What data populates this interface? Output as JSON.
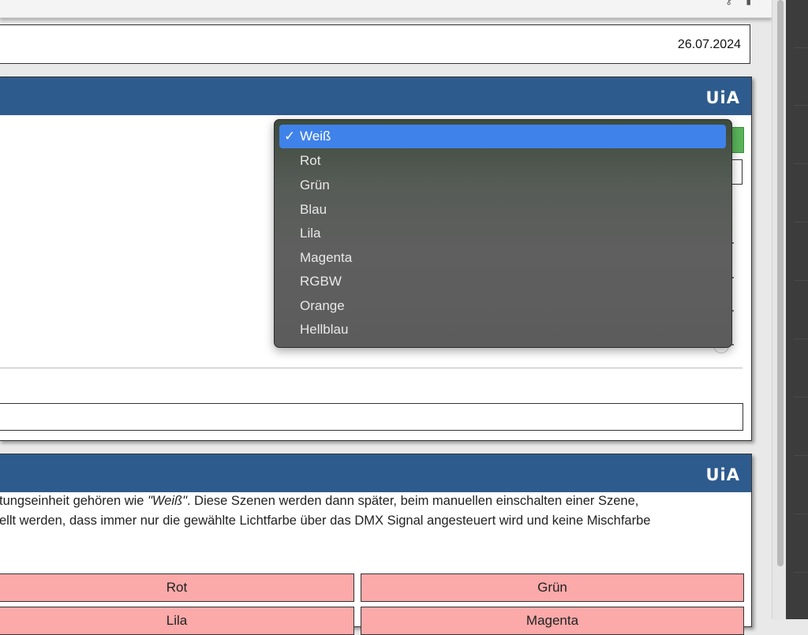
{
  "header": {
    "date": "26.07.2024",
    "logo_text": "UiA"
  },
  "panel1": {
    "logo_text": "UiA",
    "dropdown": {
      "selected": "Weiß",
      "options": [
        "Weiß",
        "Rot",
        "Grün",
        "Blau",
        "Lila",
        "Magenta",
        "RGBW",
        "Orange",
        "Hellblau"
      ]
    }
  },
  "panel2": {
    "logo_text": "UiA",
    "description": {
      "line1_pre": "tungseinheit gehören wie ",
      "line1_em": "\"Weiß\"",
      "line1_post": ". Diese Szenen werden dann später, beim manuellen einschalten einer Szene,",
      "line2": "ellt werden, dass immer nur die gewählte Lichtfarbe über das DMX Signal angesteuert wird und keine Mischfarbe"
    },
    "color_buttons": [
      {
        "label": "Rot"
      },
      {
        "label": "Grün"
      },
      {
        "label": "Lila"
      },
      {
        "label": "Magenta"
      }
    ]
  },
  "colors": {
    "panel_header": "#2e5b8d",
    "color_button": "#fba9a9",
    "dropdown_highlight": "#3f82ea",
    "green_button": "#5ab55a"
  }
}
